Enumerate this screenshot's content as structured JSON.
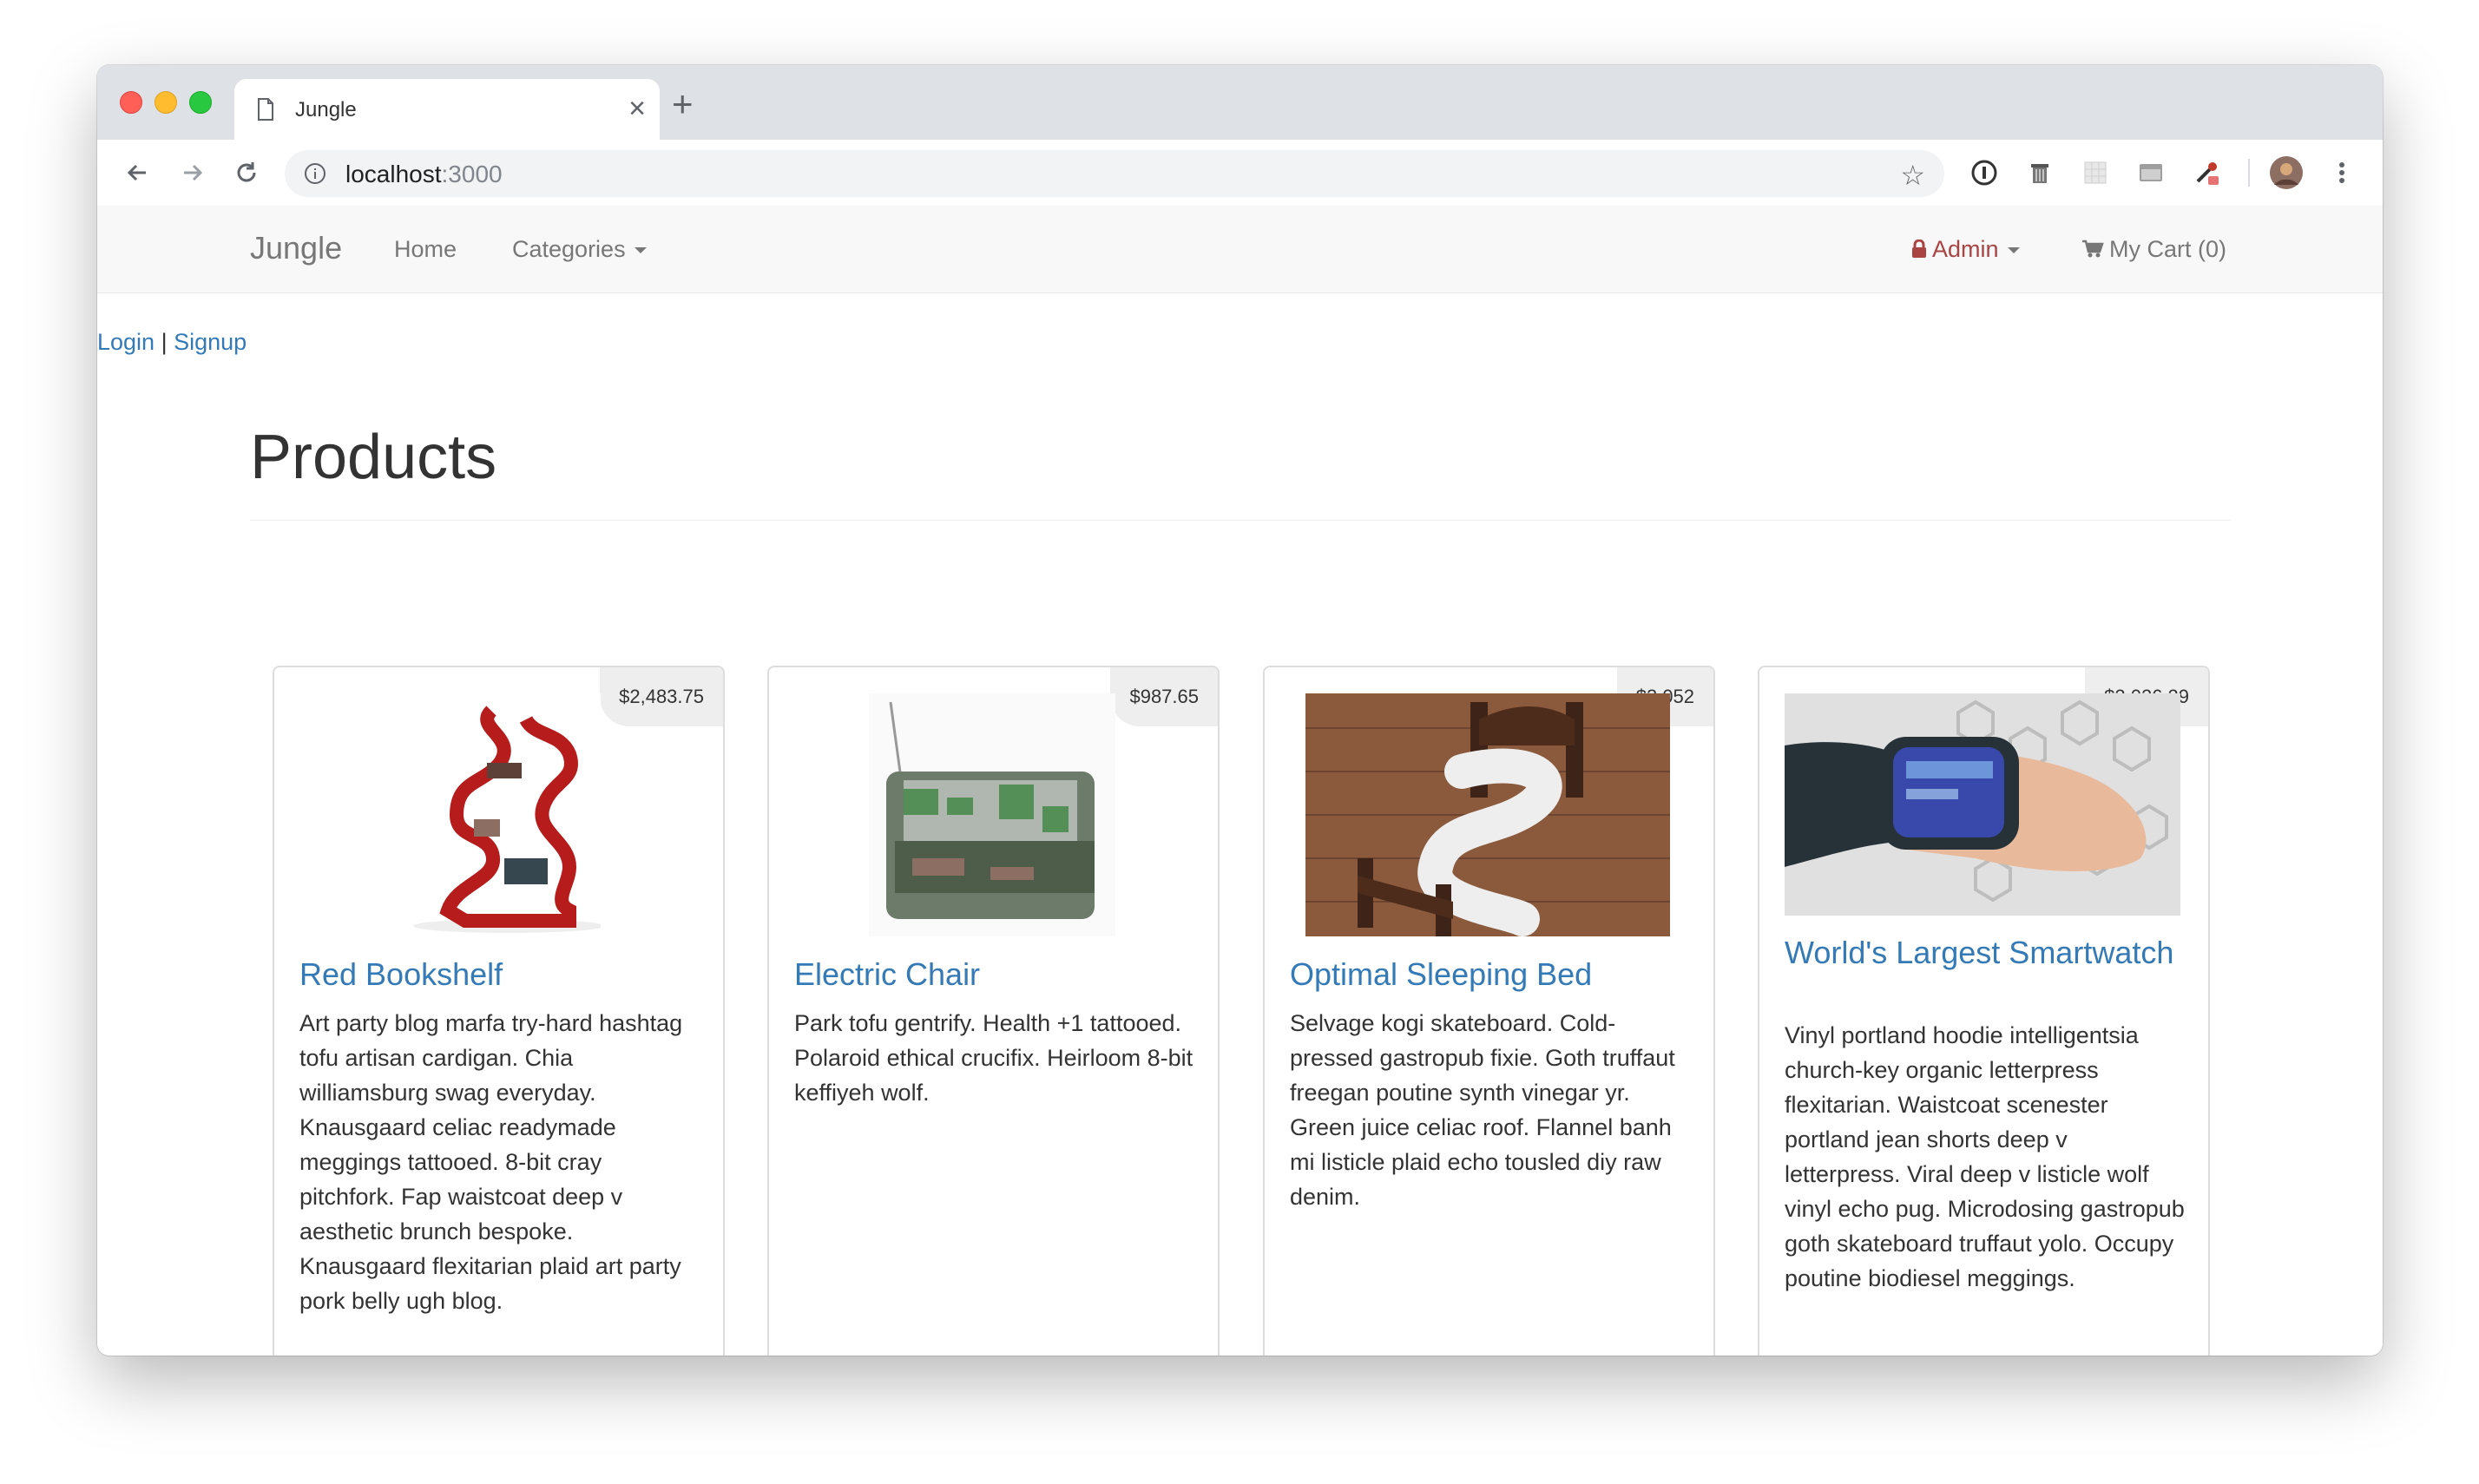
{
  "browser": {
    "tab_title": "Jungle",
    "url_host": "localhost",
    "url_port": ":3000"
  },
  "navbar": {
    "brand": "Jungle",
    "home": "Home",
    "categories": "Categories",
    "admin": "Admin",
    "cart": "My Cart (0)"
  },
  "auth": {
    "login": "Login",
    "separator": "|",
    "signup": "Signup"
  },
  "page": {
    "title": "Products"
  },
  "products": [
    {
      "name": "Red Bookshelf",
      "price": "$2,483.75",
      "description": "Art party blog marfa try-hard hashtag tofu artisan cardigan. Chia williamsburg swag everyday. Knausgaard celiac readymade meggings tattooed. 8-bit cray pitchfork. Fap waistcoat deep v aesthetic brunch bespoke. Knausgaard flexitarian plaid art party pork belly ugh blog."
    },
    {
      "name": "Electric Chair",
      "price": "$987.65",
      "description": "Park tofu gentrify. Health +1 tattooed. Polaroid ethical crucifix. Heirloom 8-bit keffiyeh wolf."
    },
    {
      "name": "Optimal Sleeping Bed",
      "price": "$3,052",
      "description": "Selvage kogi skateboard. Cold-pressed gastropub fixie. Goth truffaut freegan poutine synth vinegar yr. Green juice celiac roof. Flannel banh mi listicle plaid echo tousled diy raw denim."
    },
    {
      "name": "World's Largest Smartwatch",
      "price": "$2,026.29",
      "description": "Vinyl portland hoodie intelligentsia church-key organic letterpress flexitarian. Waistcoat scenester portland jean shorts deep v letterpress. Viral deep v listicle wolf vinyl echo pug. Microdosing gastropub goth skateboard truffaut yolo. Occupy poutine biodiesel meggings."
    }
  ],
  "colors": {
    "link": "#337ab7",
    "admin": "#a94442",
    "navbar_bg": "#f8f8f8"
  }
}
